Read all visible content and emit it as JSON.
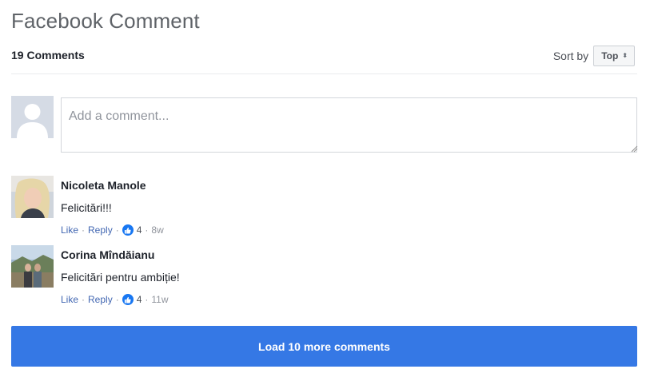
{
  "widget": {
    "title": "Facebook Comment"
  },
  "header": {
    "comment_count": "19 Comments",
    "sort_label": "Sort by",
    "sort_value": "Top"
  },
  "composer": {
    "placeholder": "Add a comment..."
  },
  "comments": [
    {
      "author": "Nicoleta Manole",
      "text": "Felicitări!!!",
      "like_label": "Like",
      "reply_label": "Reply",
      "likes": "4",
      "time": "8w"
    },
    {
      "author": "Corina Mîndăianu",
      "text": "Felicitări pentru ambiție!",
      "like_label": "Like",
      "reply_label": "Reply",
      "likes": "4",
      "time": "11w"
    }
  ],
  "footer": {
    "load_more_label": "Load 10 more comments"
  },
  "icons": {
    "like_badge": "thumbs-up-icon",
    "sort_caret": "sort-caret-icon",
    "default_avatar": "default-avatar-icon"
  },
  "colors": {
    "accent": "#3578e5",
    "link": "#4267b2",
    "like_badge": "#1877f2"
  }
}
